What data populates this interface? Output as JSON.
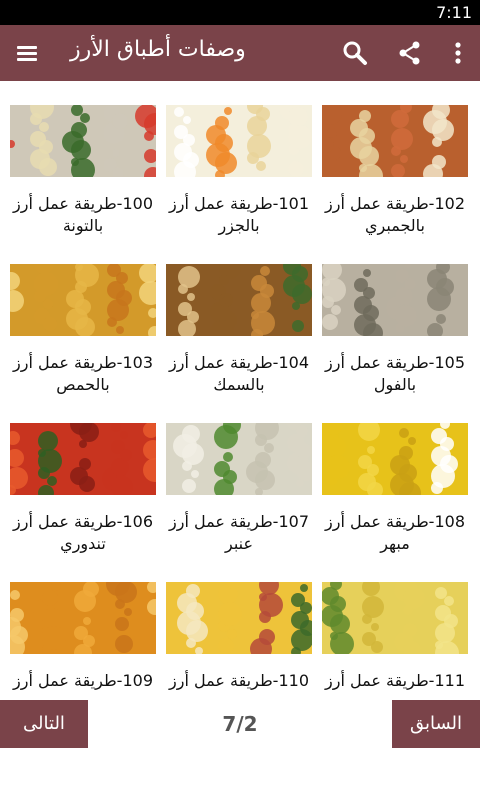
{
  "status": {
    "time": "7:11"
  },
  "appbar": {
    "title": "وصفات أطباق الأرز",
    "icons": [
      "menu-icon",
      "search-icon",
      "share-icon",
      "more-vert-icon"
    ]
  },
  "grid": {
    "items": [
      {
        "label": "102-طريقة عمل أرز بالجمبري",
        "col": 0,
        "row": 0,
        "colors": [
          "#b9602e",
          "#e8d3a0",
          "#d06b3b",
          "#f2e6c9"
        ]
      },
      {
        "label": "101-طريقة عمل أرز بالجزر",
        "col": 1,
        "row": 0,
        "colors": [
          "#f4efdc",
          "#ffffff",
          "#f08a2a",
          "#e9d39a"
        ]
      },
      {
        "label": "100-طريقة عمل أرز بالتونة",
        "col": 2,
        "row": 0,
        "colors": [
          "#cfc8b8",
          "#d63a2c",
          "#e8dcb0",
          "#3a6b2a"
        ]
      },
      {
        "label": "105-طريقة عمل أرز بالفول",
        "col": 0,
        "row": 1,
        "colors": [
          "#b8b0a0",
          "#8a8576",
          "#d9d2c2",
          "#6e6b5c"
        ]
      },
      {
        "label": "104-طريقة عمل أرز بالسمك",
        "col": 1,
        "row": 1,
        "colors": [
          "#8a5a25",
          "#c8883a",
          "#3d6b2b",
          "#e1c28a"
        ]
      },
      {
        "label": "103-طريقة عمل أرز بالحمص",
        "col": 2,
        "row": 1,
        "colors": [
          "#d39a2a",
          "#e6b646",
          "#c7761c",
          "#f2d37a"
        ]
      },
      {
        "label": "108-طريقة عمل أرز مبهر",
        "col": 0,
        "row": 2,
        "colors": [
          "#e7c21a",
          "#f2d646",
          "#c9a014",
          "#ffffff"
        ]
      },
      {
        "label": "107-طريقة عمل أرز عنبر",
        "col": 1,
        "row": 2,
        "colors": [
          "#d9d6c6",
          "#f1efe4",
          "#4f8a2f",
          "#c6c2b0"
        ]
      },
      {
        "label": "106-طريقة عمل أرز تندوري",
        "col": 2,
        "row": 2,
        "colors": [
          "#c8341f",
          "#e85a2d",
          "#2f5f22",
          "#8a1f15"
        ]
      },
      {
        "label": "111-طريقة عمل أرز",
        "col": 0,
        "row": 3,
        "colors": [
          "#e6d05a",
          "#f2e48a",
          "#5f8a2d",
          "#d1b63a"
        ]
      },
      {
        "label": "110-طريقة عمل أرز",
        "col": 1,
        "row": 3,
        "colors": [
          "#eec33a",
          "#b54a3a",
          "#3c6a2a",
          "#f5e7c0"
        ]
      },
      {
        "label": "109-طريقة عمل أرز",
        "col": 2,
        "row": 3,
        "colors": [
          "#de8d1e",
          "#f0a93a",
          "#c9741a",
          "#f6c86a"
        ]
      }
    ]
  },
  "footer": {
    "next_label": "التالى",
    "prev_label": "السابق",
    "page_indicator": "7/2"
  }
}
